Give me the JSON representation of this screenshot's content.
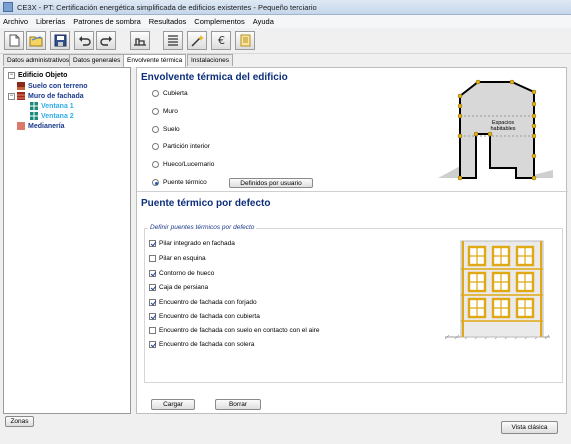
{
  "window": {
    "title": "CE3X - PT: Certificación energética simplificada de edificios existentes - Pequeño terciario"
  },
  "menu": [
    "Archivo",
    "Librerías",
    "Patrones de sombra",
    "Resultados",
    "Complementos",
    "Ayuda"
  ],
  "toolbar": [
    {
      "icon": "new-document-icon"
    },
    {
      "icon": "open-folder-icon"
    },
    {
      "icon": "save-icon"
    },
    {
      "icon": "undo-icon"
    },
    {
      "icon": "redo-icon"
    },
    {
      "icon": "building-icon"
    },
    {
      "icon": "layers-icon"
    },
    {
      "icon": "wand-icon"
    },
    {
      "icon": "euro-icon"
    },
    {
      "icon": "report-icon"
    }
  ],
  "tabs": [
    "Datos administrativos",
    "Datos generales",
    "Envolvente térmica",
    "Instalaciones"
  ],
  "tree": {
    "root": "Edificio Objeto",
    "items": [
      "Suelo con terreno",
      "Muro de fachada",
      "Ventana 1",
      "Ventana 2",
      "Medianería"
    ]
  },
  "envolvente": {
    "title": "Envolvente térmica del edificio",
    "options": [
      "Cubierta",
      "Muro",
      "Suelo",
      "Partición interior",
      "Hueco/Lucernario",
      "Puente térmico"
    ],
    "selected": "Puente térmico",
    "user_defined_button": "Definidos por usuario",
    "diagram_label": "Espacios habitables"
  },
  "puente": {
    "title": "Puente térmico por defecto",
    "group_label": "Definir puentes térmicos por defecto",
    "checks": [
      {
        "label": "Pilar integrado en fachada",
        "checked": true
      },
      {
        "label": "Pilar en esquina",
        "checked": false
      },
      {
        "label": "Contorno de hueco",
        "checked": true
      },
      {
        "label": "Caja de persiana",
        "checked": true
      },
      {
        "label": "Encuentro de fachada con forjado",
        "checked": true
      },
      {
        "label": "Encuentro de fachada con cubierta",
        "checked": true
      },
      {
        "label": "Encuentro de fachada con suelo en contacto con el aire",
        "checked": false
      },
      {
        "label": "Encuentro de fachada con solera",
        "checked": true
      }
    ],
    "load_button": "Cargar",
    "delete_button": "Borrar"
  },
  "footer": {
    "zonas": "Zonas",
    "vista_clasica": "Vista clásica"
  }
}
